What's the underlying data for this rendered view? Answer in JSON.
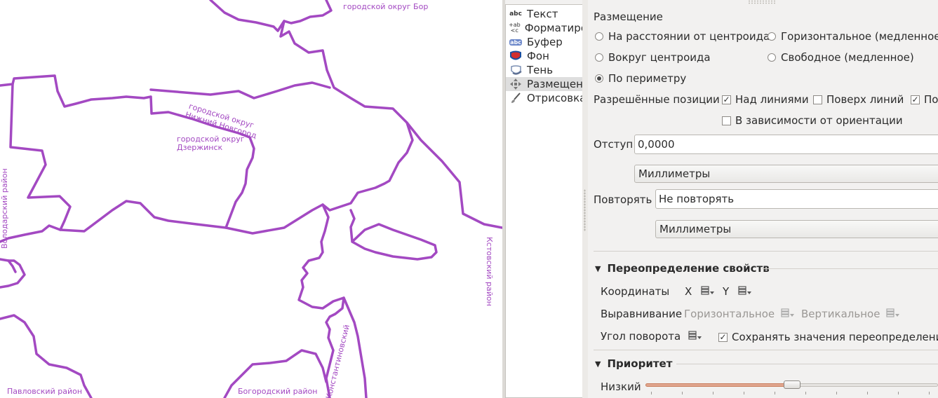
{
  "map": {
    "labels": [
      "городской округ Бор",
      "городской округ",
      "Нижний Новгород",
      "городской округ",
      "Дзержинск",
      "Володарский район",
      "Кстовский район",
      "Павловский район",
      "Богородский район",
      "Константиновский"
    ],
    "boundary_color": "#a349c2"
  },
  "nav": {
    "items": [
      {
        "label": "Текст",
        "icon": "text-abc-icon"
      },
      {
        "label": "Форматирование",
        "icon": "formatting-icon"
      },
      {
        "label": "Буфер",
        "icon": "buffer-icon"
      },
      {
        "label": "Фон",
        "icon": "background-icon"
      },
      {
        "label": "Тень",
        "icon": "shadow-icon"
      },
      {
        "label": "Размещение",
        "icon": "placement-icon"
      },
      {
        "label": "Отрисовка",
        "icon": "rendering-brush-icon"
      }
    ],
    "icon_texts": {
      "text": "abc",
      "format_top": "+ab",
      "format_bottom": "<c",
      "buffer": "abc"
    },
    "selected": "Размещение"
  },
  "placement": {
    "title": "Размещение",
    "modes": [
      {
        "label": "На расстоянии от центроида",
        "selected": false
      },
      {
        "label": "Горизонтальное (медленное)",
        "selected": false
      },
      {
        "label": "Вокруг центроида",
        "selected": false
      },
      {
        "label": "Свободное (медленное)",
        "selected": false
      },
      {
        "label": "По периметру",
        "selected": true
      }
    ],
    "allowed_positions_label": "Разрешённые позиции",
    "positions": [
      {
        "label": "Над линиями",
        "checked": true
      },
      {
        "label": "Поверх линий",
        "checked": false
      },
      {
        "label": "Под линиями",
        "checked": true
      },
      {
        "label": "В зависимости от ориентации",
        "checked": false
      }
    ],
    "offset_label": "Отступ",
    "offset_value": "0,0000",
    "offset_unit": "Миллиметры",
    "repeat_label": "Повторять",
    "repeat_value": "Не повторять",
    "repeat_unit": "Миллиметры"
  },
  "override": {
    "title": "Переопределение свойств",
    "coords_label": "Координаты",
    "x_label": "X",
    "y_label": "Y",
    "align_label": "Выравнивание",
    "align_h": "Горизонтальное",
    "align_v": "Вертикальное",
    "rotation_label": "Угол поворота",
    "keep_label": "Сохранять значения переопределения",
    "keep_checked": true
  },
  "priority": {
    "title": "Приоритет",
    "low_label": "Низкий",
    "level": 0.5
  }
}
